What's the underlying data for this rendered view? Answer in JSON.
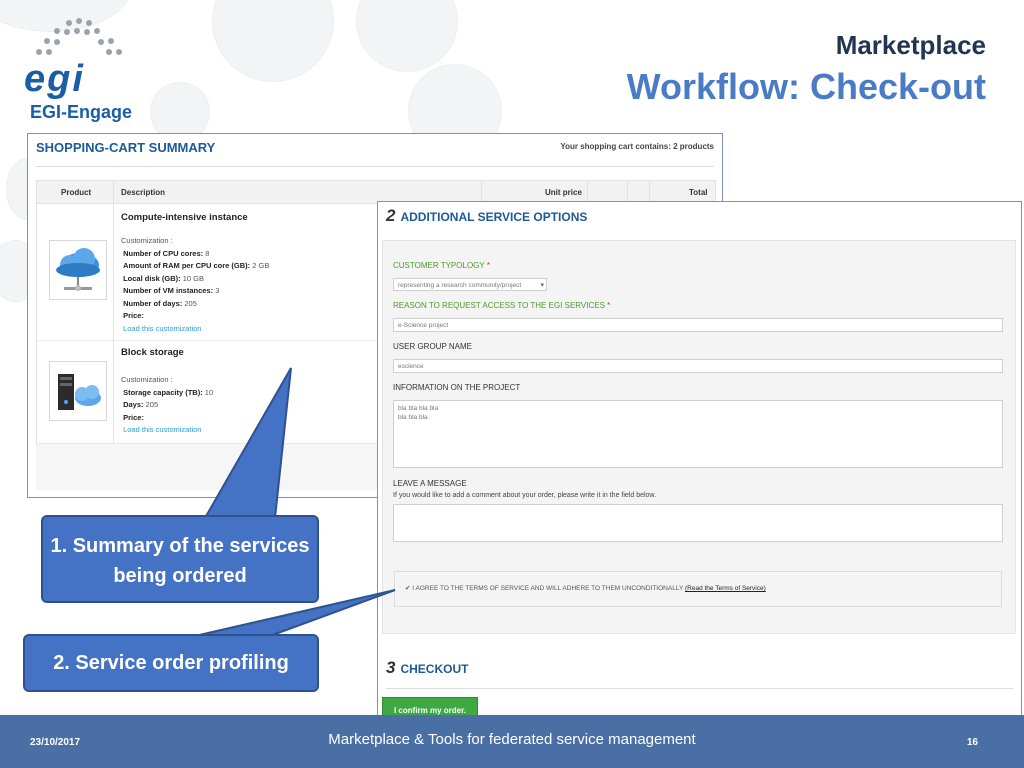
{
  "logo": {
    "mark": "egi",
    "name": "EGI-Engage"
  },
  "header": {
    "title": "Marketplace",
    "subtitle": "Workflow: Check-out"
  },
  "cart": {
    "title": "SHOPPING-CART SUMMARY",
    "info": "Your shopping cart contains: 2 products",
    "columns": [
      "Product",
      "Description",
      "Unit price",
      "Total"
    ],
    "items": [
      {
        "icon": "cloud-server-icon",
        "name": "Compute-intensive instance",
        "customization_label": "Customization :",
        "fields": [
          {
            "label": "Number of CPU cores:",
            "value": "8"
          },
          {
            "label": "Amount of RAM per CPU core (GB):",
            "value": "2 GB"
          },
          {
            "label": "Local disk (GB):",
            "value": "10 GB"
          },
          {
            "label": "Number of VM instances:",
            "value": "3"
          },
          {
            "label": "Number of days:",
            "value": "205"
          },
          {
            "label": "Price:",
            "value": ""
          }
        ],
        "link": "Load this customization"
      },
      {
        "icon": "storage-cloud-icon",
        "name": "Block storage",
        "customization_label": "Customization :",
        "fields": [
          {
            "label": "Storage capacity (TB):",
            "value": "10"
          },
          {
            "label": "Days:",
            "value": "205"
          },
          {
            "label": "Price:",
            "value": ""
          }
        ],
        "link": "Load this customization"
      }
    ]
  },
  "options": {
    "step1_num": "2",
    "step1_title": "ADDITIONAL SERVICE OPTIONS",
    "customer_typology_label": "CUSTOMER TYPOLOGY",
    "customer_typology_value": "representing a research community/project",
    "reason_label": "REASON TO REQUEST ACCESS TO THE EGI SERVICES",
    "reason_value": "e-Science project",
    "group_label": "USER GROUP NAME",
    "group_value": "escience",
    "project_label": "INFORMATION ON THE PROJECT",
    "project_value_1": "bla bla bla bla",
    "project_value_2": "bla bla bla",
    "message_label": "LEAVE A MESSAGE",
    "message_hint": "If you would like to add a comment about your order, please write it in the field below.",
    "required_mark": "*",
    "terms_text": "I AGREE TO THE TERMS OF SERVICE AND WILL ADHERE TO THEM UNCONDITIONALLY",
    "terms_link": "(Read the Terms of Service)",
    "step2_num": "3",
    "step2_title": "CHECKOUT",
    "confirm_button": "I confirm my order."
  },
  "callouts": {
    "summary": "1. Summary of the services being ordered",
    "profiling": "2. Service order profiling"
  },
  "footer": {
    "date": "23/10/2017",
    "title": "Marketplace & Tools for federated service management",
    "page": "16"
  },
  "colors": {
    "brand": "#1b5ea6",
    "accent": "#4472c4",
    "footer": "#4a6fa5",
    "confirm": "#3ea843"
  }
}
